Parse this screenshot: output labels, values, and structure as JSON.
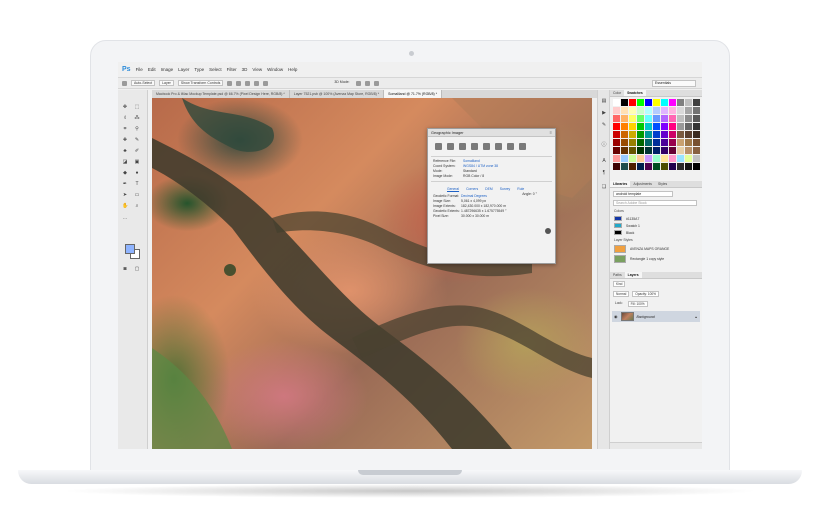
{
  "menubar": {
    "logo": "Ps",
    "items": [
      "File",
      "Edit",
      "Image",
      "Layer",
      "Type",
      "Select",
      "Filter",
      "3D",
      "View",
      "Window",
      "Help"
    ]
  },
  "options": {
    "auto_select": "Auto-Select",
    "layer": "Layer",
    "show_transform": "Show Transform Controls",
    "mode": "3D Mode:",
    "workspace": "Essentials"
  },
  "tabs": [
    {
      "label": "Macbook Pro & iMac Mockup Template.psd @ 66.7% (Pixel Design Here, RGB/8) *"
    },
    {
      "label": "Layer 7521.psb @ 100% (Avenza Map Store, RGB/8) *"
    },
    {
      "label": "Somaliland @ 71.7% (RGB/8) *"
    }
  ],
  "dialog": {
    "title": "Geographic Imager",
    "fields": [
      {
        "k": "Reference File:",
        "v": "Somaliland"
      },
      {
        "k": "Coord System:",
        "v": "WGS84 / UTM zone 38"
      },
      {
        "k": "Mode:",
        "v": "Standard"
      },
      {
        "k": "Image Mode:",
        "v": "RGB Color / 8"
      }
    ],
    "angle": "Angle: 0 °",
    "tabs": [
      "General",
      "Corners",
      "DEM",
      "Survey",
      "Rule"
    ],
    "geo_fields": [
      {
        "k": "Geodetic Format:",
        "v": "Decimal Degrees"
      },
      {
        "k": "Image Size:",
        "v": "5,061 x 4,099 px"
      },
      {
        "k": "Image Extents:",
        "v": "182,430.000 x 182,970.000 m"
      },
      {
        "k": "Geodetic Extents:",
        "v": "1.487296635 x 1.675775549 °"
      },
      {
        "k": "Pixel Size:",
        "v": "30.000 x 30.000 m"
      }
    ]
  },
  "swatches": {
    "tabs": [
      "Color",
      "Swatches"
    ]
  },
  "libraries": {
    "tabs": [
      "Libraries",
      "Adjustments",
      "Styles"
    ],
    "selected": "android template",
    "search_placeholder": "Search Adobe Stock",
    "colors_label": "Colors",
    "colors": [
      {
        "name": "#1135A7",
        "hex": "#1135a7"
      },
      {
        "name": "Swatch 1",
        "hex": "#23a9c9"
      },
      {
        "name": "Black",
        "hex": "#000000"
      }
    ],
    "styles_label": "Layer Styles",
    "styles": [
      {
        "name": "AVENZA MAPS ORANGE"
      },
      {
        "name": "Rectangle 1 copy style"
      }
    ]
  },
  "layers": {
    "tabs": [
      "Paths",
      "Layers"
    ],
    "kind": "Kind",
    "blend": "Normal",
    "opacity": "Opacity: 100%",
    "lock": "Lock:",
    "fill": "Fill: 100%",
    "rows": [
      {
        "name": "Background"
      }
    ]
  }
}
